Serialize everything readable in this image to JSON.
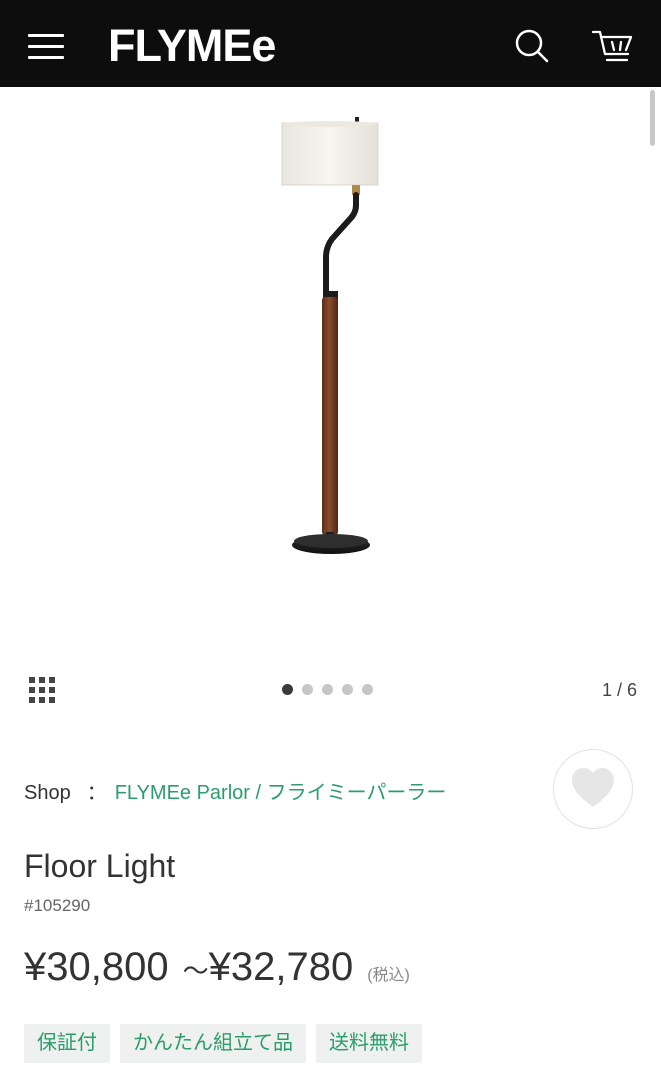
{
  "header": {
    "logo": "FLYMEe",
    "menu_icon": "hamburger-menu-icon",
    "search_icon": "search-icon",
    "cart_icon": "cart-icon",
    "background": "#0d0d0d"
  },
  "gallery": {
    "current_index": 1,
    "total_slides": 6,
    "visible_dots": 5,
    "counter_text": "1 / 6",
    "grid_icon": "grid-view-icon"
  },
  "product": {
    "shop_label": "Shop",
    "shop_separator": "：",
    "shop_name": "FLYMEe Parlor / フライミーパーラー",
    "title": "Floor Light",
    "sku": "#105290",
    "price_min": "¥30,800",
    "price_tilde": "〜",
    "price_max": "¥32,780",
    "tax_note": "(税込)",
    "favorite_icon": "heart-icon",
    "tags": [
      "保証付",
      "かんたん組立て品",
      "送料無料"
    ]
  },
  "colors": {
    "accent_green": "#2a9d6a",
    "tag_bg": "#eef1ef"
  }
}
